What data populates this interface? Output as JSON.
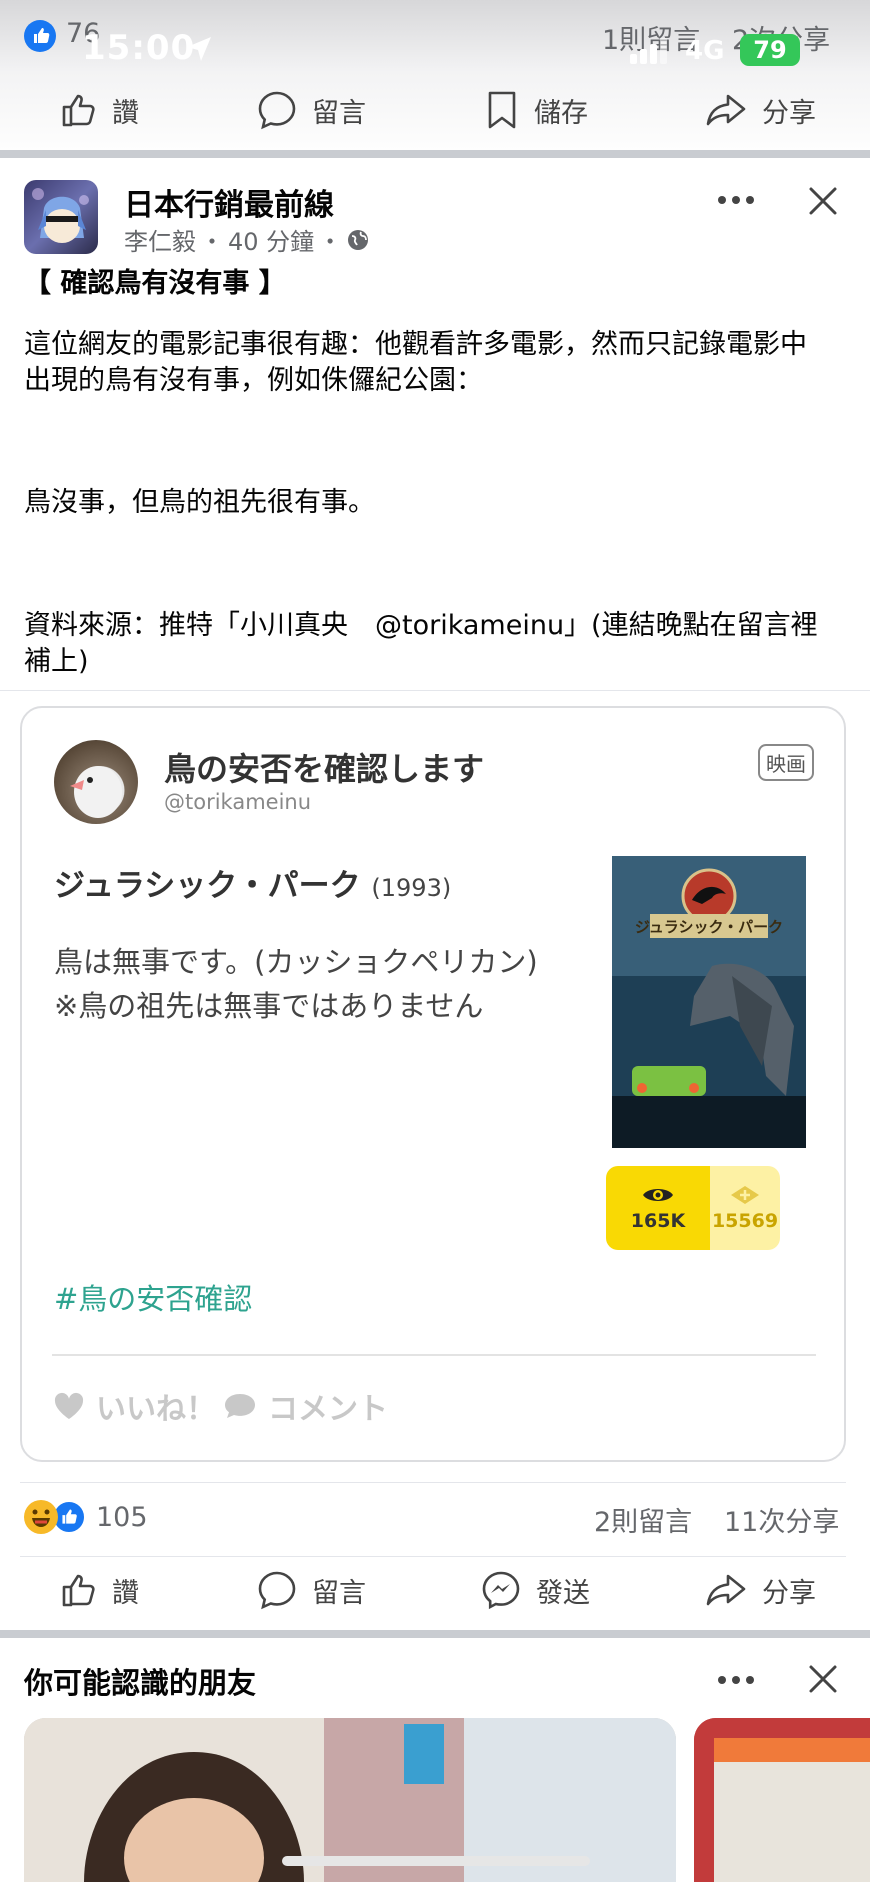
{
  "status_bar": {
    "time": "15:00",
    "network": "4G",
    "battery": "79"
  },
  "prev_post": {
    "like_count": "76",
    "comments": "1則留言",
    "shares": "2次分享",
    "actions": {
      "like": "讚",
      "comment": "留言",
      "save": "儲存",
      "share": "分享"
    }
  },
  "post": {
    "page_name": "日本行銷最前線",
    "author": "李仁毅",
    "time_ago": "40 分鐘",
    "headline": "【 確認鳥有沒有事 】",
    "para1": "這位網友的電影記事很有趣：他觀看許多電影，然而只記錄電影中\n出現的鳥有沒有事，例如侏儸紀公園：",
    "para2": "鳥沒事，但鳥的祖先很有事。",
    "para3": "資料來源：推特「小川真央　@torikameinu」(連結晚點在留言裡\n補上)",
    "card": {
      "title": "鳥の安否を確認します",
      "handle": "@torikameinu",
      "tag": "映画",
      "movie_title": "ジュラシック・パーク",
      "movie_year": "(1993)",
      "body": "鳥は無事です。(カッショクペリカン)\n※鳥の祖先は無事ではありません",
      "poster_text": "ジュラシック・パーク",
      "views": "165K",
      "points": "15569",
      "hashtag": "#鳥の安否確認",
      "like_label": "いいね！",
      "comment_label": "コメント"
    },
    "reaction_count": "105",
    "comments": "2則留言",
    "shares": "11次分享",
    "actions": {
      "like": "讚",
      "comment": "留言",
      "send": "發送",
      "share": "分享"
    }
  },
  "pymk": {
    "title": "你可能認識的朋友"
  },
  "colors": {
    "facebook_blue": "#1877f2",
    "hashtag_green": "#2ea38f",
    "yellow": "#f9d904"
  }
}
